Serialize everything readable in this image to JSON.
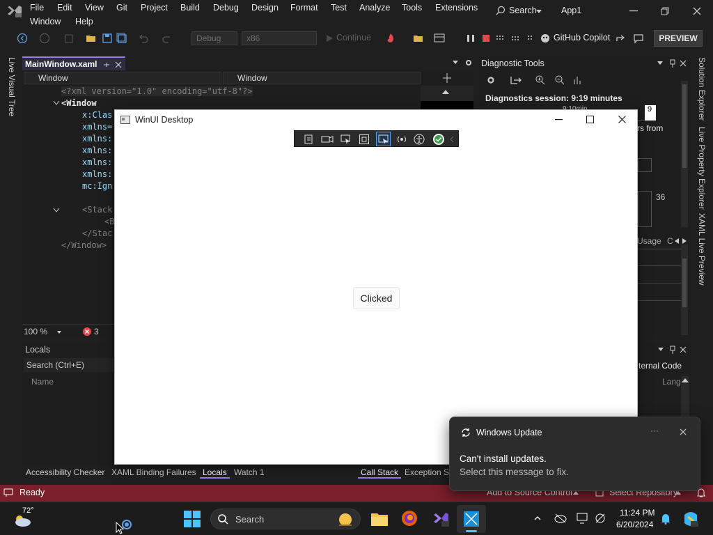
{
  "menu": {
    "items": [
      "File",
      "Edit",
      "View",
      "Git",
      "Project",
      "Build",
      "Debug",
      "Design",
      "Format",
      "Test",
      "Analyze",
      "Tools",
      "Extensions"
    ],
    "items_row2": [
      "Window",
      "Help"
    ],
    "search_label": "Search",
    "app_title": "App1"
  },
  "toolbar": {
    "config_combo": "Debug",
    "platform_combo": "x86",
    "continue_label": "Continue",
    "copilot_label": "GitHub Copilot",
    "preview_label": "PREVIEW"
  },
  "side_strips": {
    "left": "Live Visual Tree",
    "right": [
      "Solution Explorer",
      "Live Property Explorer",
      "XAML Live Preview"
    ]
  },
  "editor": {
    "tab_label": "MainWindow.xaml",
    "nav_left": "Window",
    "nav_right": "Window",
    "lines": [
      "<?xml version=\"1.0\" encoding=\"utf-8\"?>",
      "<Window",
      "x:Clas",
      "xmlns=",
      "xmlns:",
      "xmlns:",
      "xmlns:",
      "xmlns:",
      "mc:Ign",
      "<Stack",
      "<B",
      "</Stac",
      "</Window>"
    ],
    "zoom": "100 %",
    "error_count": "3"
  },
  "diagnostics": {
    "title": "Diagnostic Tools",
    "session": "Diagnostics session: 9:19 minutes",
    "timeline_label": "9:10min",
    "timeline_value": "9",
    "partial_text": "rs from",
    "value_36": "36",
    "tab_usage": "Usage",
    "tab_c": "C"
  },
  "locals": {
    "title": "Locals",
    "search_placeholder": "Search (Ctrl+E)",
    "col_name": "Name",
    "col_lang": "Lang",
    "external_code": "ternal Code"
  },
  "bottom_tabs": [
    "Accessibility Checker",
    "XAML Binding Failures",
    "Locals",
    "Watch 1",
    "Call Stack",
    "Exception Se"
  ],
  "status": {
    "ready": "Ready",
    "add_source": "Add to Source Control",
    "select_repo": "Select Repository"
  },
  "winui": {
    "title": "WinUI Desktop",
    "button_label": "Clicked"
  },
  "toast": {
    "app": "Windows Update",
    "headline": "Can't install updates.",
    "body": "Select this message to fix.",
    "more": "···"
  },
  "taskbar": {
    "weather": "72°",
    "search_label": "Search",
    "time": "11:24 PM",
    "date": "6/20/2024"
  },
  "colors": {
    "accent": "#9b7ae6",
    "status_bar": "#7a1f2b",
    "stop_red": "#e5484d"
  }
}
